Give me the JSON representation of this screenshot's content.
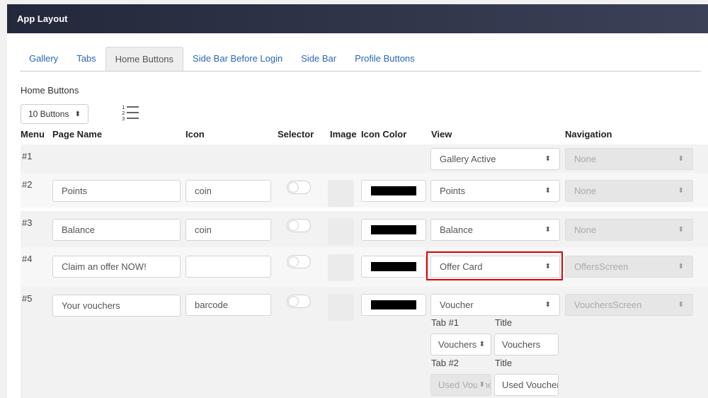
{
  "header": {
    "title": "App Layout"
  },
  "tabs": [
    {
      "label": "Gallery"
    },
    {
      "label": "Tabs"
    },
    {
      "label": "Home Buttons"
    },
    {
      "label": "Side Bar Before Login"
    },
    {
      "label": "Side Bar"
    },
    {
      "label": "Profile Buttons"
    }
  ],
  "active_tab": "Home Buttons",
  "section": {
    "label": "Home Buttons",
    "count_value": "10 Buttons"
  },
  "columns": {
    "menu": "Menu",
    "page_name": "Page Name",
    "icon": "Icon",
    "selector": "Selector",
    "image": "Image",
    "icon_color": "Icon Color",
    "view": "View",
    "navigation": "Navigation"
  },
  "rows": [
    {
      "num": "#1",
      "page_name": "",
      "icon": "",
      "view": "Gallery Active",
      "navigation": "None"
    },
    {
      "num": "#2",
      "page_name": "Points",
      "icon": "coin",
      "view": "Points",
      "navigation": "None",
      "icon_color": "#000000"
    },
    {
      "num": "#3",
      "page_name": "Balance",
      "icon": "coin",
      "view": "Balance",
      "navigation": "None",
      "icon_color": "#000000"
    },
    {
      "num": "#4",
      "page_name": "Claim an offer NOW!",
      "icon": "",
      "view": "Offer Card",
      "navigation": "OffersScreen",
      "icon_color": "#000000"
    },
    {
      "num": "#5",
      "page_name": "Your vouchers",
      "icon": "barcode",
      "view": "Voucher",
      "navigation": "VouchersScreen",
      "icon_color": "#000000",
      "sub_tabs": [
        {
          "tab_label": "Tab #1",
          "title_label": "Title",
          "select_value": "Vouchers",
          "title_value": "Vouchers"
        },
        {
          "tab_label": "Tab #2",
          "title_label": "Title",
          "select_value": "Used Vouchers",
          "title_value": "Used Vouchers"
        }
      ]
    }
  ],
  "icons": {
    "select_arrow": "⬍",
    "list": "ordered-list-icon"
  },
  "colors": {
    "header_bg": "#2b3045",
    "link": "#2a66b5",
    "highlight": "#e00000",
    "row_bg": "#f2f2f2"
  }
}
